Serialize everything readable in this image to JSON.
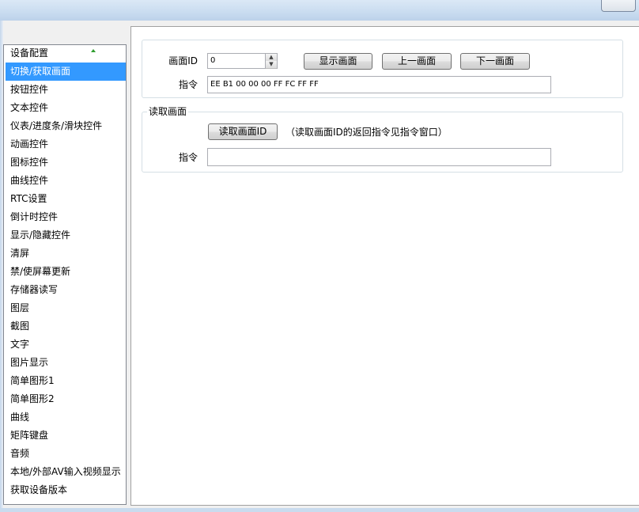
{
  "sidebar": {
    "items": [
      {
        "label": "设备配置"
      },
      {
        "label": "切换/获取画面"
      },
      {
        "label": "按钮控件"
      },
      {
        "label": "文本控件"
      },
      {
        "label": "仪表/进度条/滑块控件"
      },
      {
        "label": "动画控件"
      },
      {
        "label": "图标控件"
      },
      {
        "label": "曲线控件"
      },
      {
        "label": "RTC设置"
      },
      {
        "label": "倒计时控件"
      },
      {
        "label": "显示/隐藏控件"
      },
      {
        "label": "清屏"
      },
      {
        "label": "禁/使屏幕更新"
      },
      {
        "label": "存储器读写"
      },
      {
        "label": "图层"
      },
      {
        "label": "截图"
      },
      {
        "label": "文字"
      },
      {
        "label": "图片显示"
      },
      {
        "label": "简单图形1"
      },
      {
        "label": "简单图形2"
      },
      {
        "label": "曲线"
      },
      {
        "label": "矩阵键盘"
      },
      {
        "label": "音频"
      },
      {
        "label": "本地/外部AV输入视频显示"
      },
      {
        "label": "获取设备版本"
      }
    ],
    "selected_index": 1,
    "accent_color": "#3399ff"
  },
  "switch_screen": {
    "screen_id_label": "画面ID",
    "screen_id_value": "0",
    "show_button": "显示画面",
    "prev_button": "上一画面",
    "next_button": "下一画面",
    "command_label": "指令",
    "command_value": "EE B1 00 00 00 FF FC FF FF"
  },
  "read_screen": {
    "group_title": "读取画面",
    "read_button": "读取画面ID",
    "note": "（读取画面ID的返回指令见指令窗口）",
    "command_label": "指令",
    "command_value": ""
  }
}
